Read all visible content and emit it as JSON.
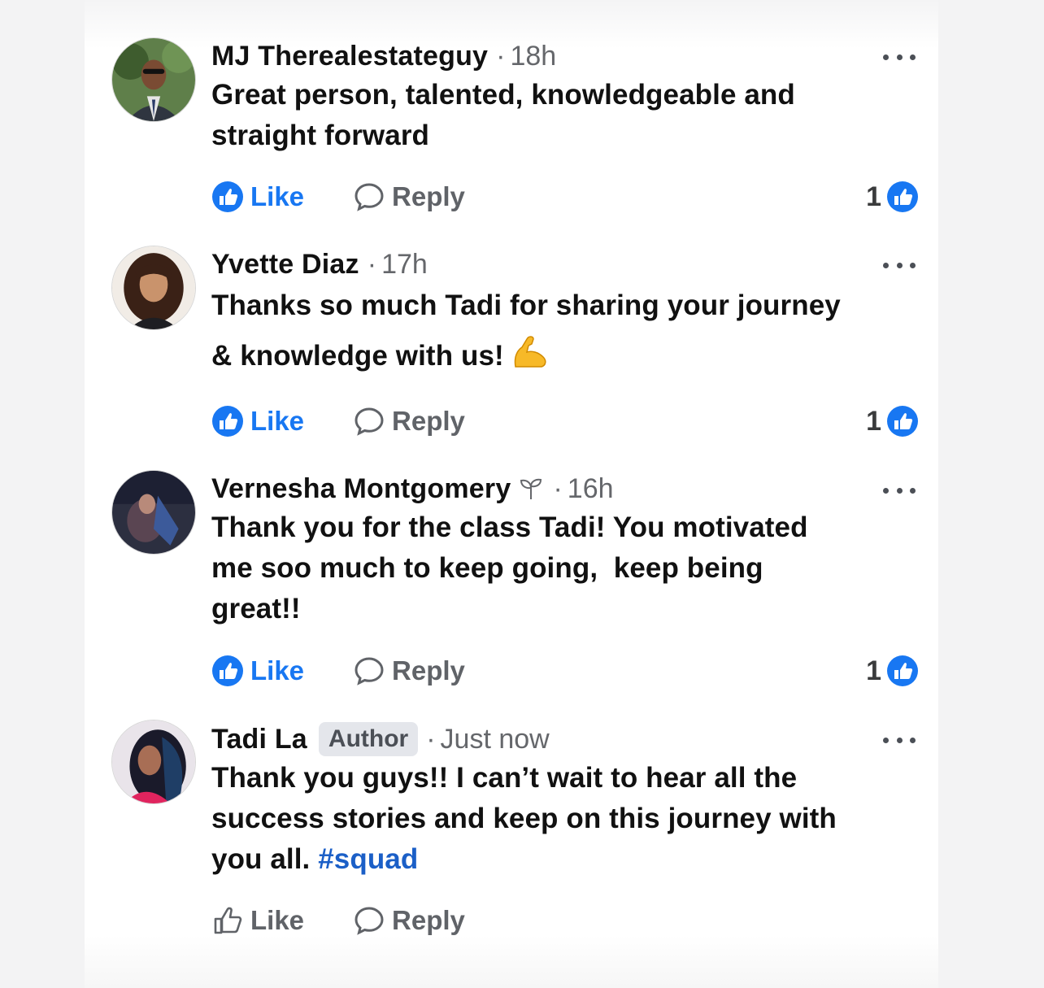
{
  "comments": [
    {
      "name": "MJ Therealestateguy",
      "time": "18h",
      "lines": [
        "Great person, talented, knowledgeable and",
        "straight forward"
      ],
      "like_label": "Like",
      "reply_label": "Reply",
      "reaction_count": "1"
    },
    {
      "name": "Yvette Diaz",
      "time": "17h",
      "lines": [
        "Thanks so much Tadi for sharing your journey",
        "& knowledge with us!"
      ],
      "emoji": "flexed-biceps-emoji",
      "like_label": "Like",
      "reply_label": "Reply",
      "reaction_count": "1"
    },
    {
      "name": "Vernesha Montgomery",
      "badge_icon": "sprout-icon",
      "time": "16h",
      "lines": [
        "Thank you for the class Tadi! You motivated",
        "me soo much to keep going,  keep being",
        "great!!"
      ],
      "like_label": "Like",
      "reply_label": "Reply",
      "reaction_count": "1"
    },
    {
      "name": "Tadi La",
      "author_badge": "Author",
      "time": "Just now",
      "lines": [
        "Thank you guys!! I can’t wait to hear all the",
        "success stories and keep on this journey with",
        "you all."
      ],
      "hashtag": "#squad",
      "like_label": "Like",
      "reply_label": "Reply"
    }
  ],
  "colors": {
    "like_blue": "#1877f2",
    "hashtag_blue": "#1b5fc7",
    "meta_gray": "#65676b"
  }
}
